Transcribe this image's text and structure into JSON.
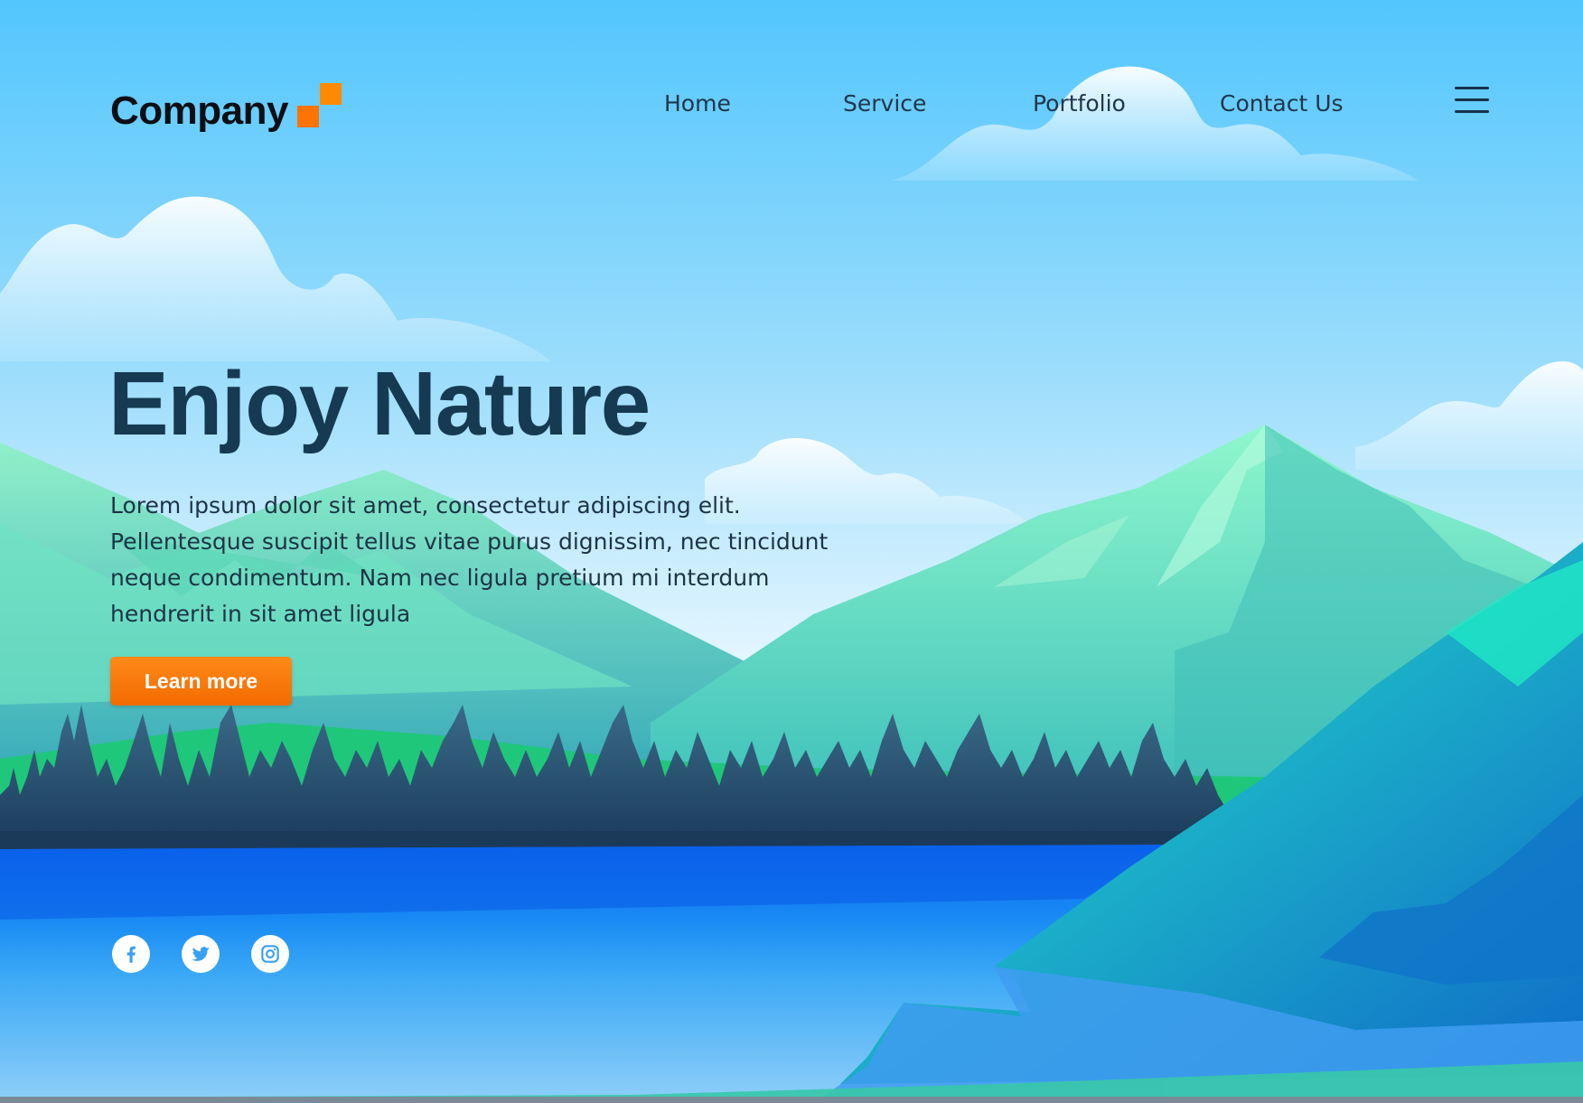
{
  "brand": {
    "name": "Company",
    "accent": "#ff8a00"
  },
  "nav": {
    "items": [
      {
        "label": "Home"
      },
      {
        "label": "Service"
      },
      {
        "label": "Portfolio"
      },
      {
        "label": "Contact Us"
      }
    ],
    "menu_icon": "hamburger-menu-icon"
  },
  "hero": {
    "title": "Enjoy Nature",
    "paragraph": "Lorem ipsum dolor sit amet, consectetur adipiscing elit. Pellentesque suscipit tellus vitae purus dignissim, nec tincidunt neque condimentum. Nam nec ligula pretium mi interdum hendrerit in sit amet ligula",
    "cta_label": "Learn more",
    "cta_color": "#f57c00"
  },
  "social": [
    {
      "icon": "facebook-icon"
    },
    {
      "icon": "twitter-icon"
    },
    {
      "icon": "instagram-icon"
    }
  ],
  "colors": {
    "sky_top": "#52c6fd",
    "sky_bottom": "#eaf8ff",
    "title": "#163a52",
    "text": "#1d3346",
    "mountain": "#6ff0c8",
    "forest": "#2e4d6e",
    "lake": "#0a6cf0"
  }
}
